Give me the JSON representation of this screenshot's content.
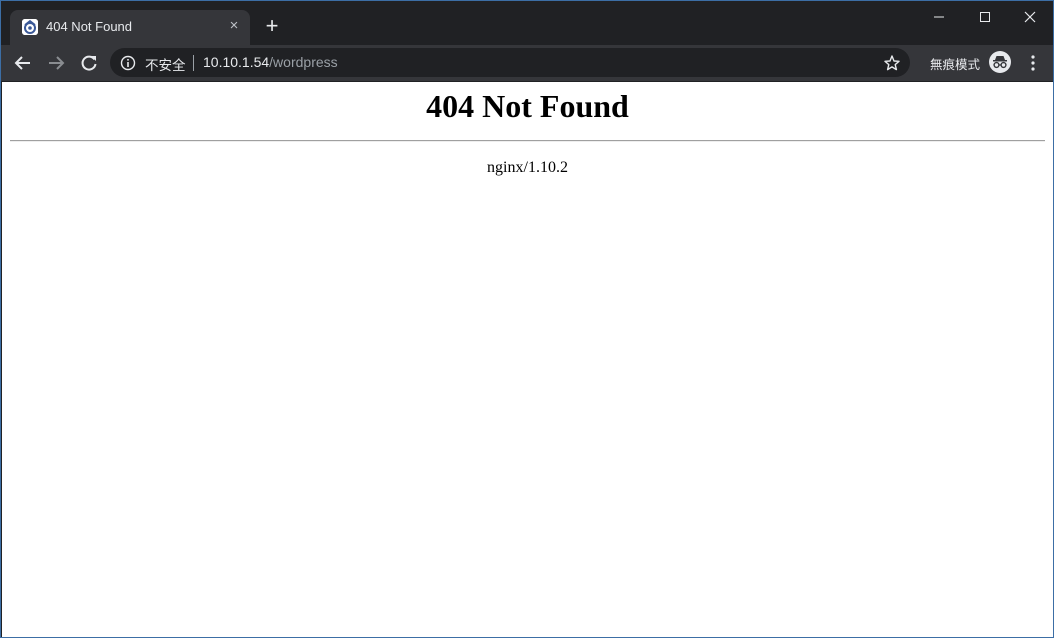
{
  "tab": {
    "title": "404 Not Found",
    "close": "×"
  },
  "new_tab": "+",
  "omnibox": {
    "security_label": "不安全",
    "url_host": "10.10.1.54",
    "url_path": "/wordpress"
  },
  "incognito_label": "無痕模式",
  "page": {
    "heading": "404 Not Found",
    "server": "nginx/1.10.2"
  }
}
